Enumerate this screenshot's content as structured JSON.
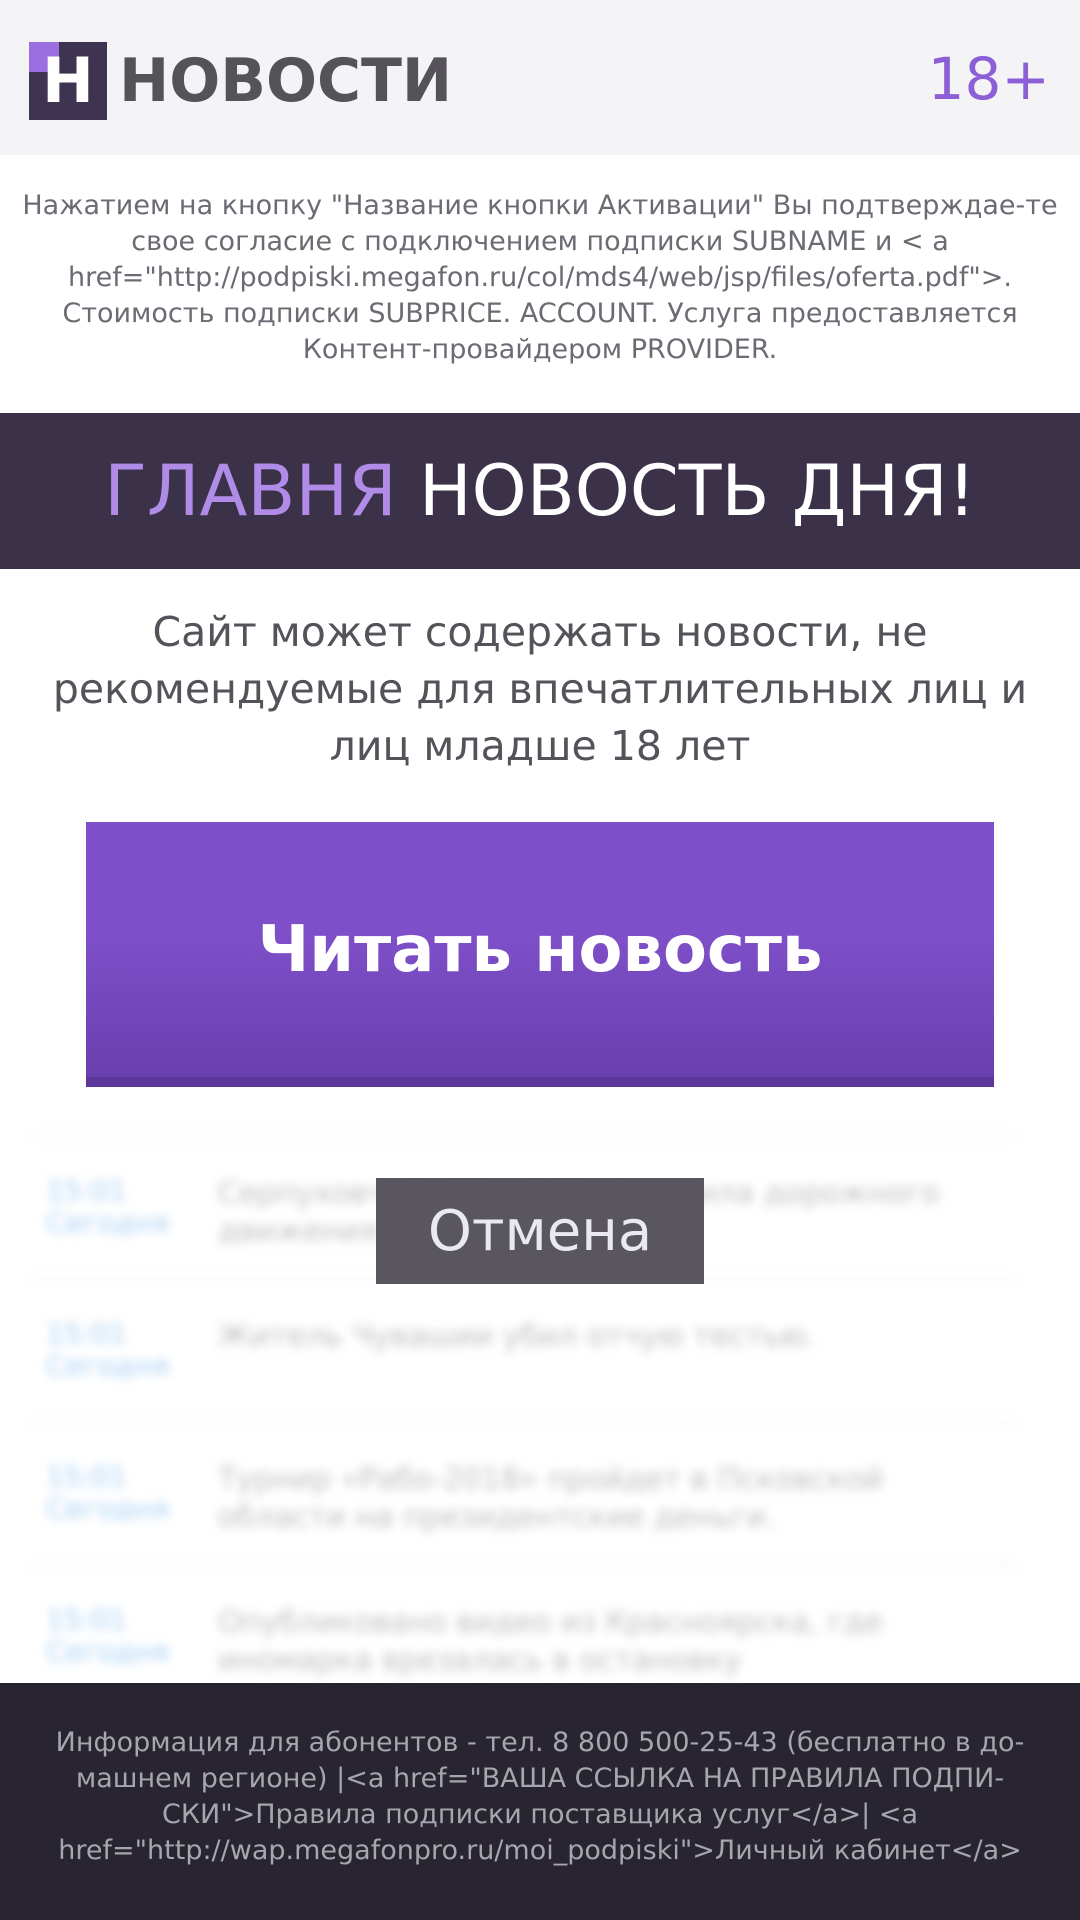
{
  "header": {
    "logo_letter": "Н",
    "logo_text": "НОВОСТИ",
    "age_rating": "18+"
  },
  "disclaimer": "Нажатием на кнопку \"Название кнопки Активации\" Вы подтверждае-те свое согласие с подключением подписки SUBNAME и < a href=\"http://podpiski.megafon.ru/col/mds4/web/jsp/files/oferta.pdf\">. Стоимость подписки SUBPRICE. ACCOUNT. Услуга предоставляется Контент-провайдером PROVIDER.",
  "banner": {
    "accent": "ГЛАВНЯ",
    "rest": " НОВОСТЬ ДНЯ!"
  },
  "warning": "Сайт может содержать новости, не рекомендуемые для впечатлительных лиц и лиц младше 18 лет",
  "read_button": "Читать новость",
  "cancel_button": "Отмена",
  "news": [
    {
      "time": "15:01",
      "day": "Сегодня",
      "title": "Серпуховчанин нарушил правила дорожного движения"
    },
    {
      "time": "15:01",
      "day": "Сегодня",
      "title": "Житель Чувашии убил отчую тестью."
    },
    {
      "time": "15:01",
      "day": "Сегодня",
      "title": "Турнир «Рабо-2018» пройдет в Псковской области на президентские деньги."
    },
    {
      "time": "15:01",
      "day": "Сегодня",
      "title": "Опубликовано видео из Красноярска, где иномарка врезалась в остановку"
    }
  ],
  "footer": "Информация для абонентов - тел. 8 800 500-25-43 (бесплатно в до-машнем регионе) |<a href=\"ВАША ССЫЛКА НА ПРАВИЛА ПОДПИ-СКИ\">Правила подписки поставщика услуг</a>| <a href=\"http://wap.megafonpro.ru/moi_podpiski\">Личный кабинет</a>",
  "colors": {
    "accent_purple": "#7e4fc8",
    "banner_bg": "#3b3249",
    "footer_bg": "#282430"
  }
}
